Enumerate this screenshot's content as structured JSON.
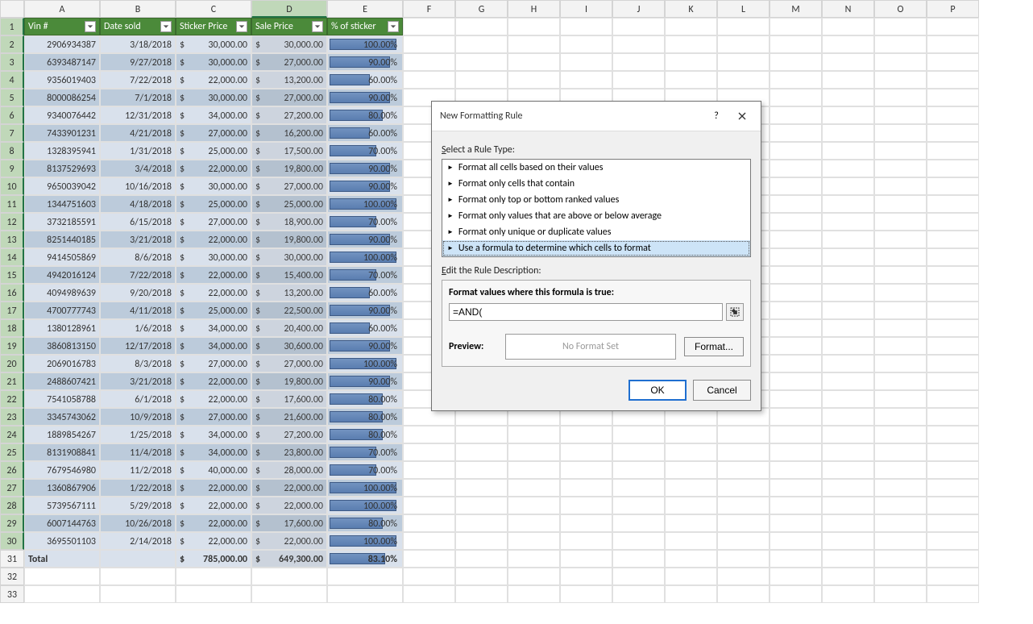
{
  "columns": [
    "A",
    "B",
    "C",
    "D",
    "E",
    "F",
    "G",
    "H",
    "I",
    "J",
    "K",
    "L",
    "M",
    "N",
    "O",
    "P"
  ],
  "selected_column_index": 3,
  "headers": [
    "Vin #",
    "Date sold",
    "Sticker Price",
    "Sale Price",
    "% of sticker"
  ],
  "rows": [
    {
      "n": 2,
      "vin": "2906934387",
      "date": "3/18/2018",
      "sticker": "30,000.00",
      "sale": "30,000.00",
      "pct": "100.00%",
      "bar": 100
    },
    {
      "n": 3,
      "vin": "6393487147",
      "date": "9/27/2018",
      "sticker": "30,000.00",
      "sale": "27,000.00",
      "pct": "90.00%",
      "bar": 90
    },
    {
      "n": 4,
      "vin": "9356019403",
      "date": "7/22/2018",
      "sticker": "22,000.00",
      "sale": "13,200.00",
      "pct": "60.00%",
      "bar": 60
    },
    {
      "n": 5,
      "vin": "8000086254",
      "date": "7/1/2018",
      "sticker": "30,000.00",
      "sale": "27,000.00",
      "pct": "90.00%",
      "bar": 90
    },
    {
      "n": 6,
      "vin": "9340076442",
      "date": "12/31/2018",
      "sticker": "34,000.00",
      "sale": "27,200.00",
      "pct": "80.00%",
      "bar": 80
    },
    {
      "n": 7,
      "vin": "7433901231",
      "date": "4/21/2018",
      "sticker": "27,000.00",
      "sale": "16,200.00",
      "pct": "60.00%",
      "bar": 60
    },
    {
      "n": 8,
      "vin": "1328395941",
      "date": "1/31/2018",
      "sticker": "25,000.00",
      "sale": "17,500.00",
      "pct": "70.00%",
      "bar": 70
    },
    {
      "n": 9,
      "vin": "8137529693",
      "date": "3/4/2018",
      "sticker": "22,000.00",
      "sale": "19,800.00",
      "pct": "90.00%",
      "bar": 90
    },
    {
      "n": 10,
      "vin": "9650039042",
      "date": "10/16/2018",
      "sticker": "30,000.00",
      "sale": "27,000.00",
      "pct": "90.00%",
      "bar": 90
    },
    {
      "n": 11,
      "vin": "1344751603",
      "date": "4/18/2018",
      "sticker": "25,000.00",
      "sale": "25,000.00",
      "pct": "100.00%",
      "bar": 100
    },
    {
      "n": 12,
      "vin": "3732185591",
      "date": "6/15/2018",
      "sticker": "27,000.00",
      "sale": "18,900.00",
      "pct": "70.00%",
      "bar": 70
    },
    {
      "n": 13,
      "vin": "8251440185",
      "date": "3/21/2018",
      "sticker": "22,000.00",
      "sale": "19,800.00",
      "pct": "90.00%",
      "bar": 90
    },
    {
      "n": 14,
      "vin": "9414505869",
      "date": "8/6/2018",
      "sticker": "30,000.00",
      "sale": "30,000.00",
      "pct": "100.00%",
      "bar": 100
    },
    {
      "n": 15,
      "vin": "4942016124",
      "date": "7/22/2018",
      "sticker": "22,000.00",
      "sale": "15,400.00",
      "pct": "70.00%",
      "bar": 70
    },
    {
      "n": 16,
      "vin": "4094989639",
      "date": "9/20/2018",
      "sticker": "22,000.00",
      "sale": "13,200.00",
      "pct": "60.00%",
      "bar": 60
    },
    {
      "n": 17,
      "vin": "4700777743",
      "date": "4/11/2018",
      "sticker": "25,000.00",
      "sale": "22,500.00",
      "pct": "90.00%",
      "bar": 90
    },
    {
      "n": 18,
      "vin": "1380128961",
      "date": "1/6/2018",
      "sticker": "34,000.00",
      "sale": "20,400.00",
      "pct": "60.00%",
      "bar": 60
    },
    {
      "n": 19,
      "vin": "3860813150",
      "date": "12/17/2018",
      "sticker": "34,000.00",
      "sale": "30,600.00",
      "pct": "90.00%",
      "bar": 90
    },
    {
      "n": 20,
      "vin": "2069016783",
      "date": "8/3/2018",
      "sticker": "27,000.00",
      "sale": "27,000.00",
      "pct": "100.00%",
      "bar": 100
    },
    {
      "n": 21,
      "vin": "2488607421",
      "date": "3/21/2018",
      "sticker": "22,000.00",
      "sale": "19,800.00",
      "pct": "90.00%",
      "bar": 90
    },
    {
      "n": 22,
      "vin": "7541058788",
      "date": "6/1/2018",
      "sticker": "22,000.00",
      "sale": "17,600.00",
      "pct": "80.00%",
      "bar": 80
    },
    {
      "n": 23,
      "vin": "3345743062",
      "date": "10/9/2018",
      "sticker": "27,000.00",
      "sale": "21,600.00",
      "pct": "80.00%",
      "bar": 80
    },
    {
      "n": 24,
      "vin": "1889854267",
      "date": "1/25/2018",
      "sticker": "34,000.00",
      "sale": "27,200.00",
      "pct": "80.00%",
      "bar": 80
    },
    {
      "n": 25,
      "vin": "8131908841",
      "date": "11/4/2018",
      "sticker": "34,000.00",
      "sale": "23,800.00",
      "pct": "70.00%",
      "bar": 70
    },
    {
      "n": 26,
      "vin": "7679546980",
      "date": "11/2/2018",
      "sticker": "40,000.00",
      "sale": "28,000.00",
      "pct": "70.00%",
      "bar": 70
    },
    {
      "n": 27,
      "vin": "1360867906",
      "date": "1/22/2018",
      "sticker": "22,000.00",
      "sale": "22,000.00",
      "pct": "100.00%",
      "bar": 100
    },
    {
      "n": 28,
      "vin": "5739567111",
      "date": "5/29/2018",
      "sticker": "22,000.00",
      "sale": "22,000.00",
      "pct": "100.00%",
      "bar": 100
    },
    {
      "n": 29,
      "vin": "6007144763",
      "date": "10/26/2018",
      "sticker": "22,000.00",
      "sale": "17,600.00",
      "pct": "80.00%",
      "bar": 80
    },
    {
      "n": 30,
      "vin": "3695501103",
      "date": "2/14/2018",
      "sticker": "22,000.00",
      "sale": "22,000.00",
      "pct": "100.00%",
      "bar": 100
    }
  ],
  "total": {
    "label": "Total",
    "sticker": "785,000.00",
    "sale": "649,300.00",
    "pct": "83.10%",
    "bar": 83.1
  },
  "extra_rows": [
    32,
    33
  ],
  "dialog": {
    "title": "New Formatting Rule",
    "help": "?",
    "select_label": "Select a Rule Type:",
    "types": [
      "Format all cells based on their values",
      "Format only cells that contain",
      "Format only top or bottom ranked values",
      "Format only values that are above or below average",
      "Format only unique or duplicate values",
      "Use a formula to determine which cells to format"
    ],
    "selected_type_index": 5,
    "edit_label": "Edit the Rule Description:",
    "formula_label": "Format values where this formula is true:",
    "formula_value": "=AND(",
    "preview_label": "Preview:",
    "preview_text": "No Format Set",
    "format_btn": "Format...",
    "ok": "OK",
    "cancel": "Cancel"
  },
  "currency": "$"
}
